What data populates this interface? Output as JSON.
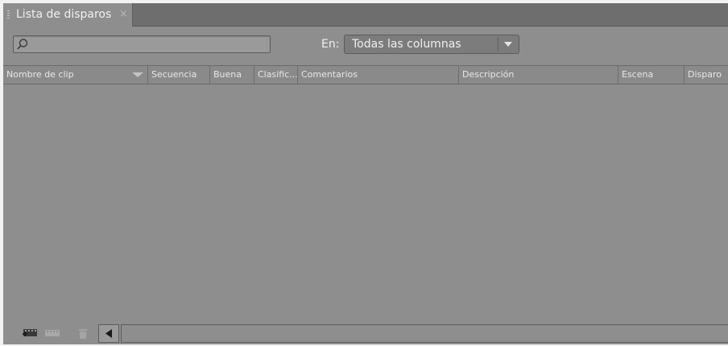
{
  "tab": {
    "title": "Lista de disparos",
    "close_glyph": "×"
  },
  "search": {
    "placeholder": "",
    "value": "",
    "icon": "search-icon"
  },
  "filter": {
    "label": "En:",
    "selected": "Todas las columnas"
  },
  "columns": [
    {
      "key": "nombre",
      "label": "Nombre de clip",
      "sorted": "descending"
    },
    {
      "key": "secuencia",
      "label": "Secuencia"
    },
    {
      "key": "buena",
      "label": "Buena"
    },
    {
      "key": "clasific",
      "label": "Clasific..."
    },
    {
      "key": "comentarios",
      "label": "Comentarios"
    },
    {
      "key": "descripcion",
      "label": "Descripción"
    },
    {
      "key": "escena",
      "label": "Escena"
    },
    {
      "key": "disparo",
      "label": "Disparo"
    }
  ],
  "rows": [],
  "footer_icons": [
    "new-clip-icon",
    "merge-clips-icon",
    "trash-icon",
    "scroll-left-icon"
  ],
  "colors": {
    "panel": "#8e8e8e",
    "tabbar": "#6e6e6e",
    "text": "#f0f0f0"
  }
}
